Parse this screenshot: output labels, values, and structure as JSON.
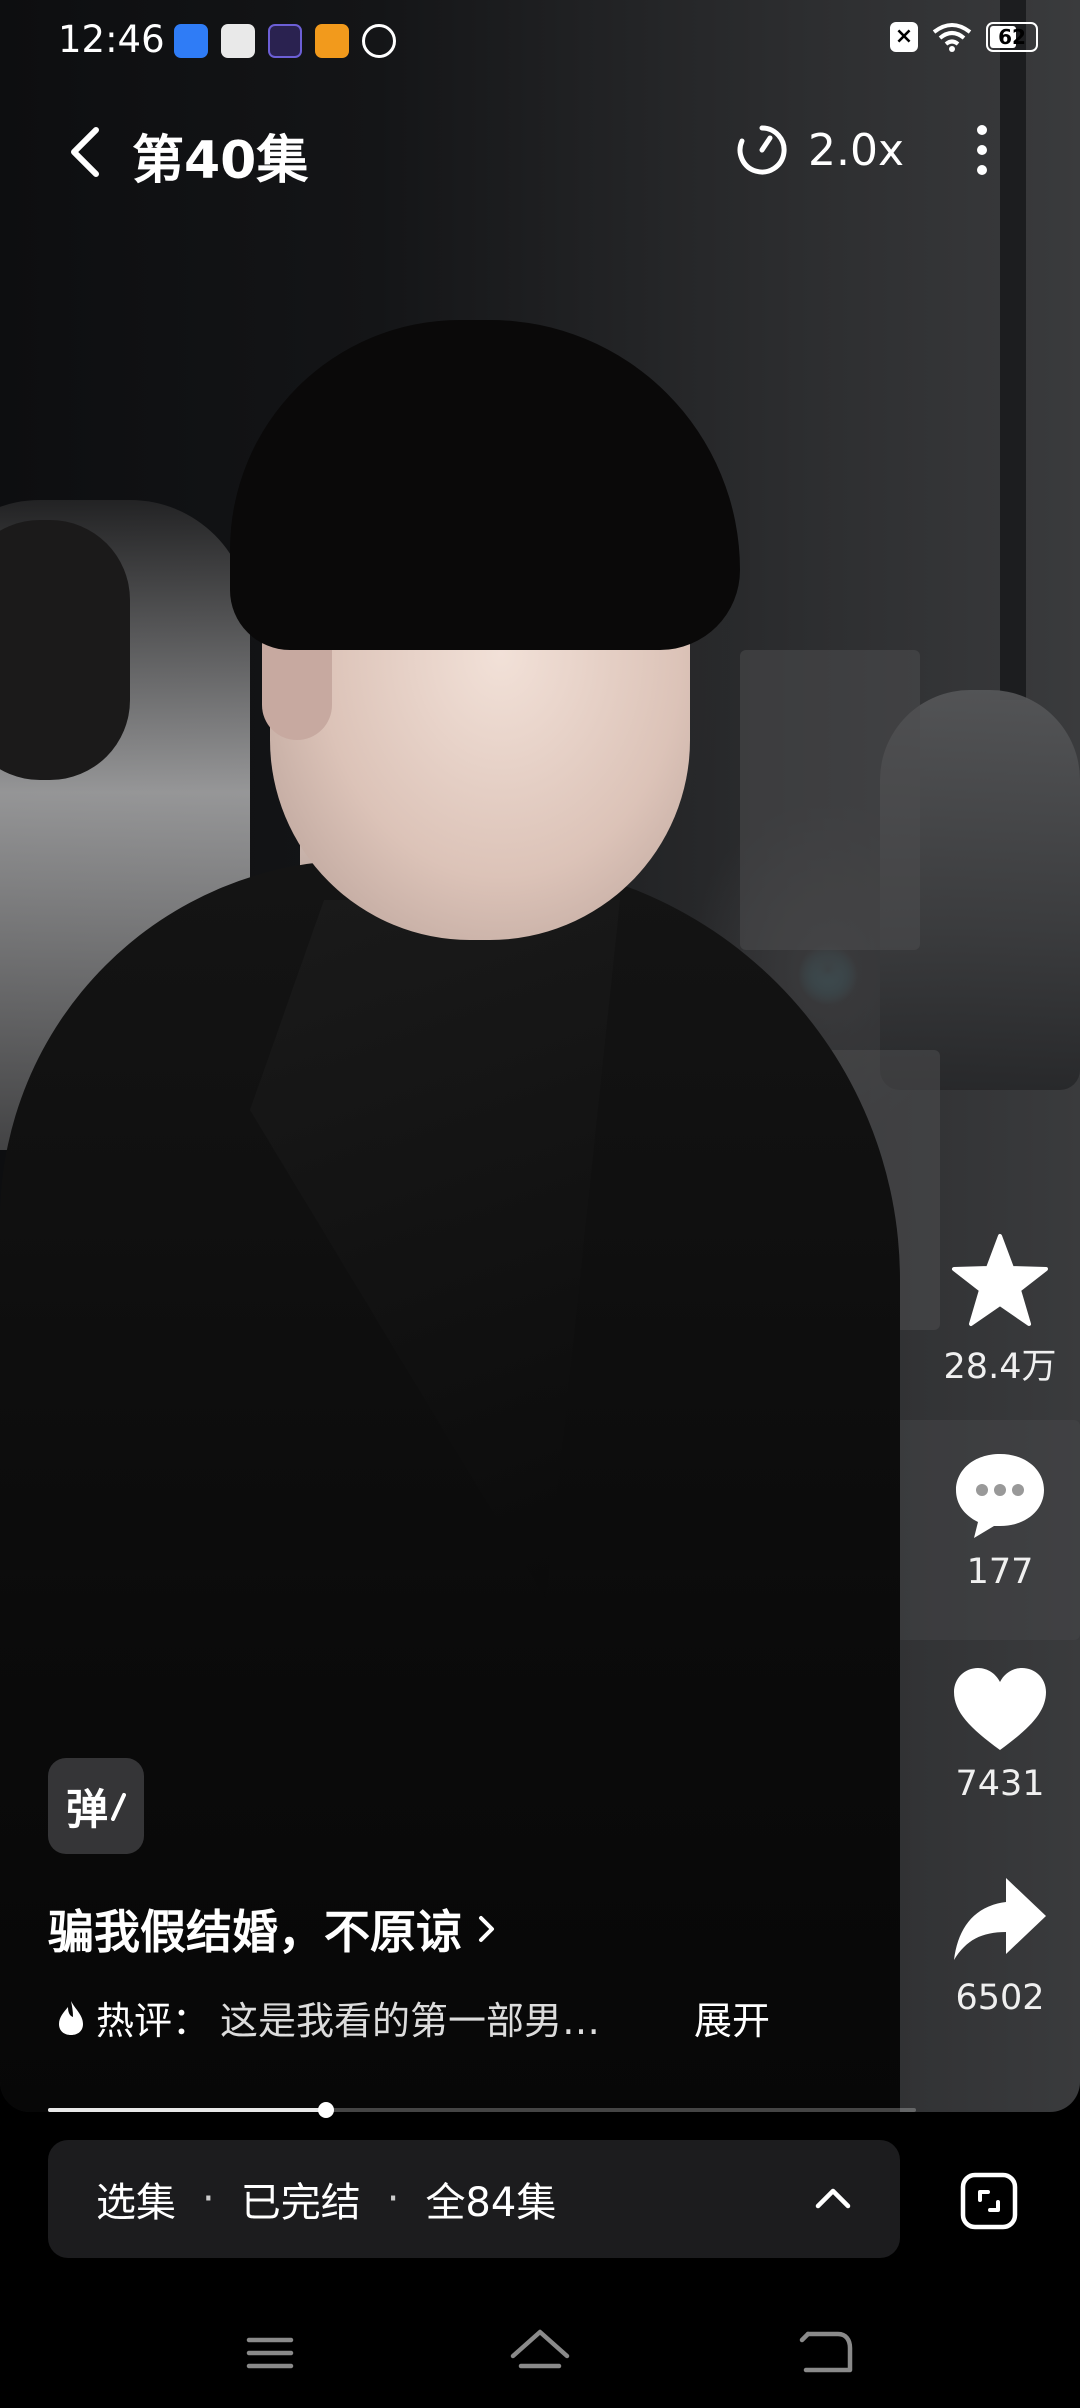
{
  "status_bar": {
    "time": "12:46",
    "notification_icons": [
      "baidu-app-icon",
      "news-app-icon",
      "video-app-icon",
      "game-app-icon",
      "link-app-icon"
    ],
    "sim_indicator": "×",
    "battery_level": "62",
    "battery_fraction": 0.62
  },
  "topbar": {
    "episode_title": "第40集",
    "speed_label": "2.0x"
  },
  "side_actions": {
    "favorite_count": "28.4万",
    "comment_count": "177",
    "like_count": "7431",
    "share_count": "6502"
  },
  "danmaku_toggle": "弹",
  "drama": {
    "title": "骗我假结婚，不原谅",
    "hot_comment_prefix": "热评：",
    "hot_comment_text": "这是我看的第一部男…",
    "expand_label": "展开"
  },
  "playback": {
    "progress_fraction": 0.32
  },
  "episode_bar": {
    "select_label": "选集",
    "status_label": "已完结",
    "total_label": "全84集",
    "separator": "·"
  },
  "colors": {
    "background": "#000000",
    "accent_text": "#ffffff",
    "bar_bg": "#1c1c1e"
  }
}
